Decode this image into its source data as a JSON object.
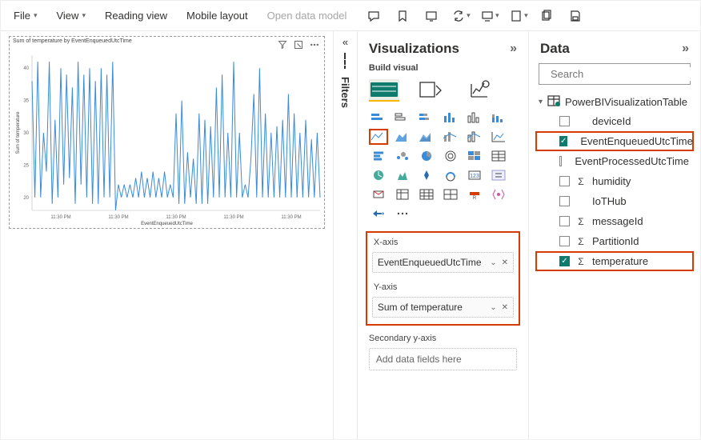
{
  "toolbar": {
    "file": "File",
    "view": "View",
    "reading": "Reading view",
    "mobile": "Mobile layout",
    "open_model": "Open data model"
  },
  "filters_rail": {
    "label": "Filters"
  },
  "chart_data": {
    "type": "line",
    "title": "Sum of temperature by EventEnqueuedUtcTime",
    "xlabel": "EventEnqueuedUtcTime",
    "ylabel": "Sum of temperature",
    "y_ticks": [
      20,
      25,
      30,
      35,
      40
    ],
    "x_ticks": [
      "11:30 PM",
      "11:30 PM",
      "11:30 PM",
      "11:30 PM",
      "11:30 PM"
    ],
    "ylim": [
      18,
      42
    ],
    "series": [
      {
        "name": "temperature",
        "values": [
          38,
          20,
          41,
          20,
          30,
          24,
          41,
          19,
          32,
          20,
          40,
          22,
          39,
          23,
          37,
          19,
          41,
          22,
          39,
          20,
          40,
          19,
          38,
          19,
          40,
          20,
          39,
          20,
          41,
          18,
          22,
          20,
          22,
          20,
          22,
          20,
          23,
          20,
          24,
          20,
          23,
          20,
          24,
          20,
          23,
          20,
          24,
          20,
          22,
          20,
          33,
          19,
          35,
          19,
          27,
          20,
          26,
          19,
          33,
          19,
          32,
          19,
          31,
          20,
          37,
          20,
          39,
          20,
          30,
          20,
          41,
          20,
          30,
          20,
          22,
          20,
          26,
          36,
          20,
          40,
          20,
          33,
          20,
          30,
          20,
          31,
          20,
          32,
          20,
          36,
          20,
          33,
          20,
          30,
          20,
          32,
          20,
          29,
          20,
          30,
          20
        ]
      }
    ]
  },
  "viz_pane": {
    "title": "Visualizations",
    "subtitle": "Build visual",
    "xaxis_label": "X-axis",
    "xaxis_value": "EventEnqueuedUtcTime",
    "yaxis_label": "Y-axis",
    "yaxis_value": "Sum of temperature",
    "secondary_label": "Secondary y-axis",
    "secondary_placeholder": "Add data fields here"
  },
  "data_pane": {
    "title": "Data",
    "search_placeholder": "Search",
    "table_name": "PowerBIVisualizationTable",
    "fields": [
      {
        "name": "deviceId",
        "checked": false,
        "sigma": false,
        "hl": false
      },
      {
        "name": "EventEnqueuedUtcTime",
        "checked": true,
        "sigma": false,
        "hl": true
      },
      {
        "name": "EventProcessedUtcTime",
        "checked": false,
        "sigma": false,
        "hl": false
      },
      {
        "name": "humidity",
        "checked": false,
        "sigma": true,
        "hl": false
      },
      {
        "name": "IoTHub",
        "checked": false,
        "sigma": false,
        "hl": false
      },
      {
        "name": "messageId",
        "checked": false,
        "sigma": true,
        "hl": false
      },
      {
        "name": "PartitionId",
        "checked": false,
        "sigma": true,
        "hl": false
      },
      {
        "name": "temperature",
        "checked": true,
        "sigma": true,
        "hl": true
      }
    ]
  }
}
